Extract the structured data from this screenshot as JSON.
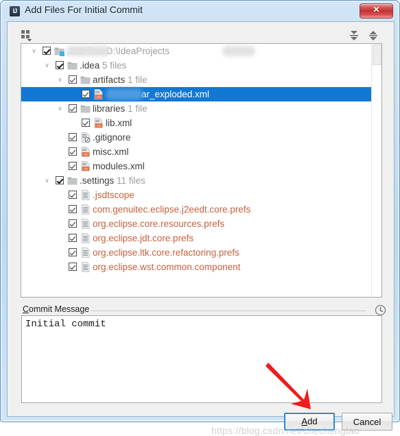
{
  "window": {
    "title": "Add Files For Initial Commit",
    "app_icon_text": "IJ",
    "close_icon": "close-icon"
  },
  "toolbar": {
    "group_by_icon": "group-by-icon",
    "expand_all_icon": "expand-all-icon",
    "collapse_all_icon": "collapse-all-icon"
  },
  "tree": {
    "rows": [
      {
        "indent": 0,
        "twisty": "∨",
        "label": "",
        "count": ",135 files  D:\\IdeaProjects",
        "icon": "folder-module-icon",
        "selected": false,
        "redacted": true
      },
      {
        "indent": 1,
        "twisty": "∨",
        "label": ".idea",
        "count": "5 files",
        "icon": "folder-icon",
        "selected": false
      },
      {
        "indent": 2,
        "twisty": "∨",
        "label": "artifacts",
        "count": "1 file",
        "icon": "folder-icon",
        "selected": false
      },
      {
        "indent": 3,
        "twisty": "",
        "label": "ar_exploded.xml",
        "count": "",
        "icon": "xml-file-icon",
        "selected": true,
        "redacted": true
      },
      {
        "indent": 2,
        "twisty": "∨",
        "label": "libraries",
        "count": "1 file",
        "icon": "folder-icon",
        "selected": false
      },
      {
        "indent": 3,
        "twisty": "",
        "label": "lib.xml",
        "count": "",
        "icon": "xml-file-icon",
        "selected": false
      },
      {
        "indent": 2,
        "twisty": "",
        "label": ".gitignore",
        "count": "",
        "icon": "gitignore-file-icon",
        "selected": false
      },
      {
        "indent": 2,
        "twisty": "",
        "label": "misc.xml",
        "count": "",
        "icon": "xml-file-icon",
        "selected": false
      },
      {
        "indent": 2,
        "twisty": "",
        "label": "modules.xml",
        "count": "",
        "icon": "xml-file-icon",
        "selected": false
      },
      {
        "indent": 1,
        "twisty": "∨",
        "label": ".settings",
        "count": "11 files",
        "icon": "folder-icon",
        "selected": false
      },
      {
        "indent": 2,
        "twisty": "",
        "label": ".jsdtscope",
        "count": "",
        "icon": "prefs-file-icon",
        "selected": false,
        "prefs": true
      },
      {
        "indent": 2,
        "twisty": "",
        "label": "com.genuitec.eclipse.j2eedt.core.prefs",
        "count": "",
        "icon": "prefs-file-icon",
        "selected": false,
        "prefs": true
      },
      {
        "indent": 2,
        "twisty": "",
        "label": "org.eclipse.core.resources.prefs",
        "count": "",
        "icon": "prefs-file-icon",
        "selected": false,
        "prefs": true
      },
      {
        "indent": 2,
        "twisty": "",
        "label": "org.eclipse.jdt.core.prefs",
        "count": "",
        "icon": "prefs-file-icon",
        "selected": false,
        "prefs": true
      },
      {
        "indent": 2,
        "twisty": "",
        "label": "org.eclipse.ltk.core.refactoring.prefs",
        "count": "",
        "icon": "prefs-file-icon",
        "selected": false,
        "prefs": true
      },
      {
        "indent": 2,
        "twisty": "",
        "label": "org.eclipse.wst.common.component",
        "count": "",
        "icon": "prefs-file-icon",
        "selected": false,
        "prefs": true
      }
    ],
    "scrollbar": "tree-vertical-scrollbar"
  },
  "commit_message": {
    "label_accel": "C",
    "label_rest": "ommit Message",
    "value": "Initial commit",
    "history_icon": "clock-icon"
  },
  "buttons": {
    "add_accel": "A",
    "add_rest": "dd",
    "cancel_label": "Cancel"
  },
  "annotation": {
    "arrow_color": "#ee1c1c",
    "arrow_name": "red-pointer-arrow"
  },
  "watermark": {
    "text": "https://blog.csdn.net/chechengtao"
  },
  "colors": {
    "selection_blue": "#1278d4",
    "focus_blue": "#2b8ad1",
    "prefs_text": "#c4603f",
    "count_text": "#9d9d9d"
  }
}
